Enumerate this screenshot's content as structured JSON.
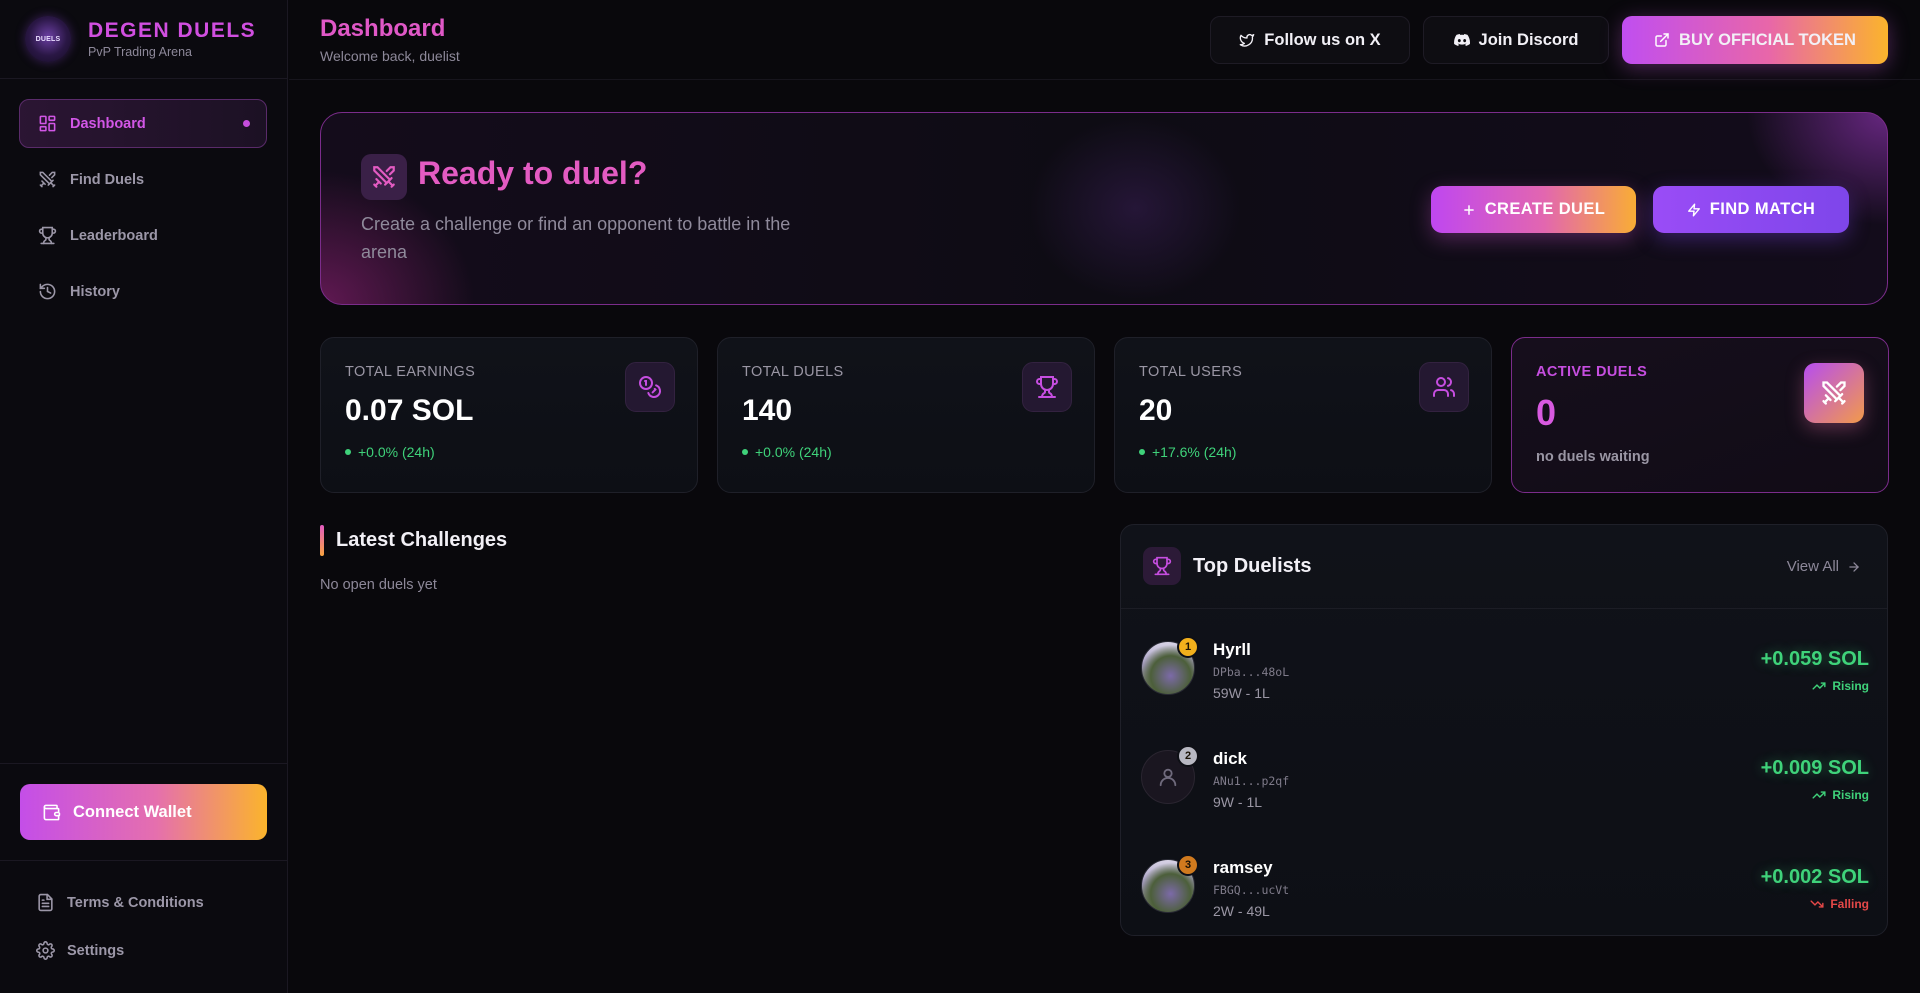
{
  "brand": {
    "logo_text": "DUELS",
    "title": "DEGEN DUELS",
    "subtitle": "PvP Trading Arena"
  },
  "sidebar": {
    "items": [
      {
        "label": "Dashboard",
        "icon": "dashboard-grid-icon",
        "active": true
      },
      {
        "label": "Find Duels",
        "icon": "crossed-swords-icon",
        "active": false
      },
      {
        "label": "Leaderboard",
        "icon": "trophy-icon",
        "active": false
      },
      {
        "label": "History",
        "icon": "history-icon",
        "active": false
      }
    ],
    "connect_wallet": "Connect Wallet",
    "footer": [
      {
        "label": "Terms & Conditions",
        "icon": "document-icon"
      },
      {
        "label": "Settings",
        "icon": "gear-icon"
      }
    ]
  },
  "header": {
    "title": "Dashboard",
    "subtitle": "Welcome back, duelist",
    "follow_x": "Follow us on X",
    "join_discord": "Join Discord",
    "buy_token": "BUY OFFICIAL TOKEN"
  },
  "hero": {
    "title": "Ready to duel?",
    "subtitle": "Create a challenge or find an opponent to battle in the arena",
    "create_duel": "CREATE DUEL",
    "find_match": "FIND MATCH"
  },
  "stats": [
    {
      "label": "TOTAL EARNINGS",
      "value": "0.07 SOL",
      "delta": "+0.0% (24h)",
      "icon": "coins-icon"
    },
    {
      "label": "TOTAL DUELS",
      "value": "140",
      "delta": "+0.0% (24h)",
      "icon": "trophy-icon"
    },
    {
      "label": "TOTAL USERS",
      "value": "20",
      "delta": "+17.6% (24h)",
      "icon": "users-icon"
    },
    {
      "label": "ACTIVE DUELS",
      "value": "0",
      "note": "no duels waiting",
      "icon": "crossed-swords-icon"
    }
  ],
  "latest": {
    "title": "Latest Challenges",
    "empty": "No open duels yet"
  },
  "top_duelists": {
    "title": "Top Duelists",
    "view_all": "View All",
    "rows": [
      {
        "rank": "1",
        "name": "Hyrll",
        "address": "DPba...48oL",
        "record": "59W - 1L",
        "pnl": "+0.059 SOL",
        "trend": "Rising"
      },
      {
        "rank": "2",
        "name": "dick",
        "address": "ANu1...p2qf",
        "record": "9W - 1L",
        "pnl": "+0.009 SOL",
        "trend": "Rising"
      },
      {
        "rank": "3",
        "name": "ramsey",
        "address": "FBGQ...ucVt",
        "record": "2W - 49L",
        "pnl": "+0.002 SOL",
        "trend": "Falling"
      }
    ]
  },
  "colors": {
    "accent_pink": "#e35bc2",
    "accent_purple": "#c64ee0",
    "gain_green": "#3fd27a",
    "loss_red": "#e54848",
    "gold": "#f2b01c"
  }
}
